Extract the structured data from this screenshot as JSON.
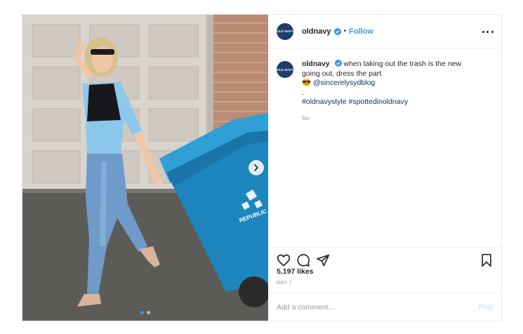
{
  "post": {
    "photo": {
      "description_icon": "photo",
      "carousel_total": 2,
      "carousel_active": 1
    },
    "header": {
      "username": "oldnavy",
      "avatar_text": "OLD NAVY",
      "follow_label": "Follow",
      "separator": "•"
    },
    "caption": {
      "username": "oldnavy",
      "text": "when taking out the trash is the new going out, dress the part",
      "emoji": "😎",
      "mention": "@sincerelysydblog",
      "dot": ".",
      "hashtags": "#oldnavystyle #spottedinoldnavy",
      "time_ago": "5w"
    },
    "stats": {
      "likes": "5,197 likes",
      "date": "MAY 7"
    },
    "comment": {
      "placeholder": "Add a comment...",
      "post_label": "Post"
    },
    "colors": {
      "accent": "#3897f0",
      "brand_navy": "#1f3d6b",
      "post_disabled": "#b2dffc"
    }
  }
}
